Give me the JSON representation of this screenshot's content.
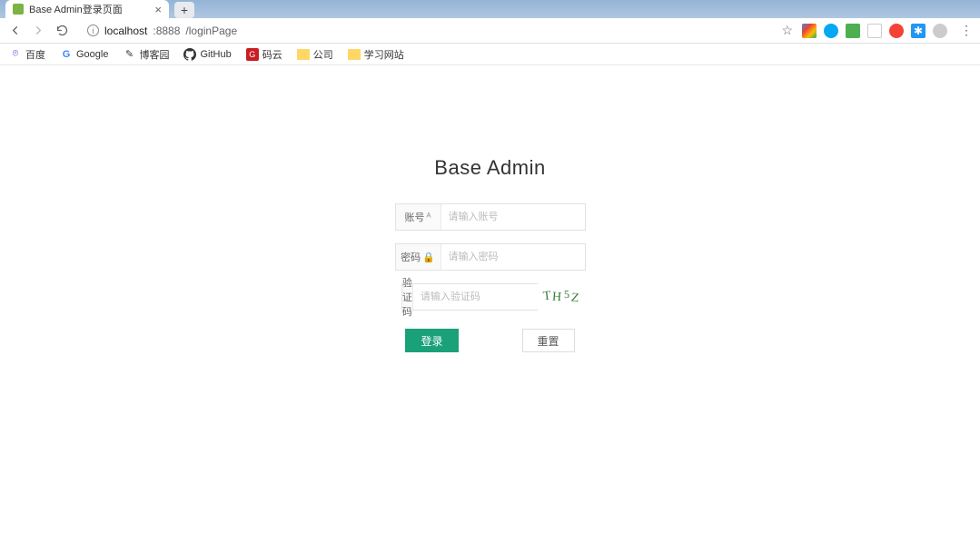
{
  "browser": {
    "tab_title": "Base Admin登录页面",
    "url": {
      "host": "localhost",
      "port": ":8888",
      "path": "/loginPage"
    }
  },
  "bookmarks": {
    "baidu": "百度",
    "google": "Google",
    "cnblogs": "博客园",
    "github": "GitHub",
    "gitee": "码云",
    "company": "公司",
    "study": "学习网站"
  },
  "page": {
    "title": "Base Admin",
    "account_label": "账号",
    "account_placeholder": "请输入账号",
    "password_label": "密码",
    "password_placeholder": "请输入密码",
    "captcha_label": "验证码",
    "captcha_placeholder": "请输入验证码",
    "captcha_value": "TH5Z",
    "login_button": "登录",
    "reset_button": "重置"
  },
  "colors": {
    "primary": "#1aa179"
  }
}
